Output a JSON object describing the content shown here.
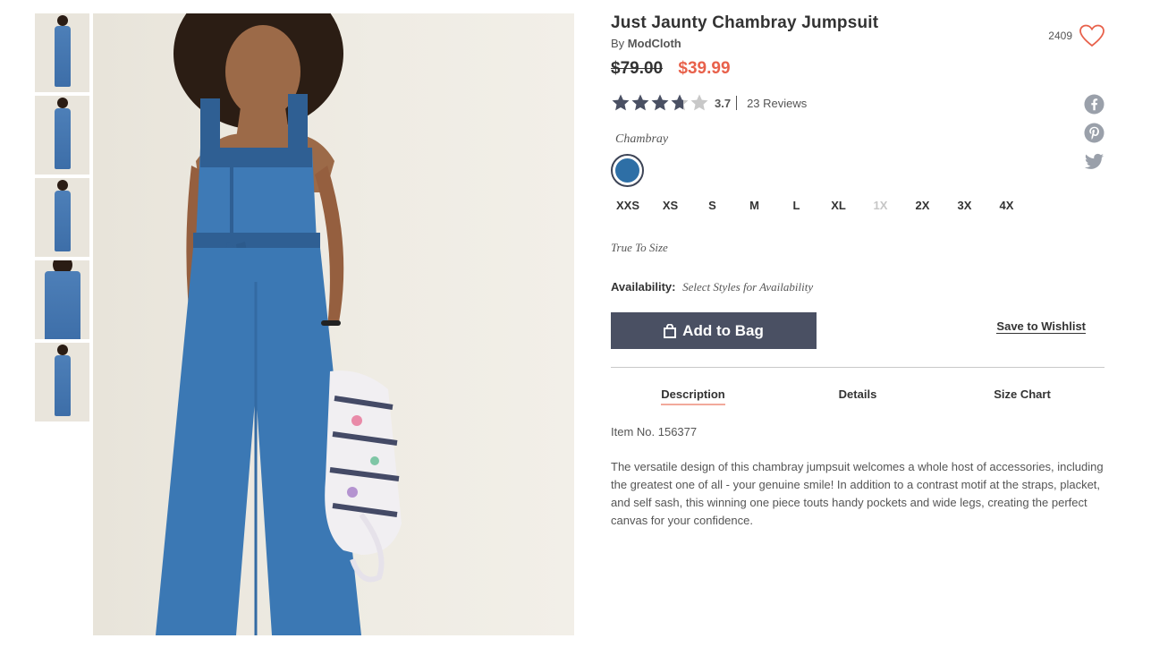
{
  "product": {
    "title": "Just Jaunty Chambray Jumpsuit",
    "brand_prefix": "By",
    "brand": "ModCloth",
    "old_price": "$79.00",
    "new_price": "$39.99",
    "favorites_count": "2409",
    "rating": "3.7",
    "rating_value": 3.7,
    "reviews": "23 Reviews",
    "color_label": "Chambray",
    "color_swatch": "#2e6fa6",
    "sizes": [
      {
        "label": "XXS",
        "available": true
      },
      {
        "label": "XS",
        "available": true
      },
      {
        "label": "S",
        "available": true
      },
      {
        "label": "M",
        "available": true
      },
      {
        "label": "L",
        "available": true
      },
      {
        "label": "XL",
        "available": true
      },
      {
        "label": "1X",
        "available": false
      },
      {
        "label": "2X",
        "available": true
      },
      {
        "label": "3X",
        "available": true
      },
      {
        "label": "4X",
        "available": true
      }
    ],
    "fit": "True To Size",
    "availability_label": "Availability:",
    "availability_value": "Select Styles for Availability",
    "add_to_bag": "Add to Bag",
    "save_to_wishlist": "Save to Wishlist",
    "tabs": [
      "Description",
      "Details",
      "Size Chart"
    ],
    "item_no": "Item No. 156377",
    "description": "The versatile design of this chambray jumpsuit welcomes a whole host of accessories, including the greatest one of all - your genuine smile! In addition to a contrast motif at the straps, placket, and self sash, this winning one piece touts handy pockets and wide legs, creating the perfect canvas for your confidence."
  },
  "colors": {
    "accent": "#e8614b",
    "button": "#4a5063",
    "icon": "#9aa0aa"
  },
  "icons": {
    "heart": "heart-icon",
    "facebook": "facebook-icon",
    "pinterest": "pinterest-icon",
    "twitter": "twitter-icon",
    "bag": "bag-icon"
  }
}
